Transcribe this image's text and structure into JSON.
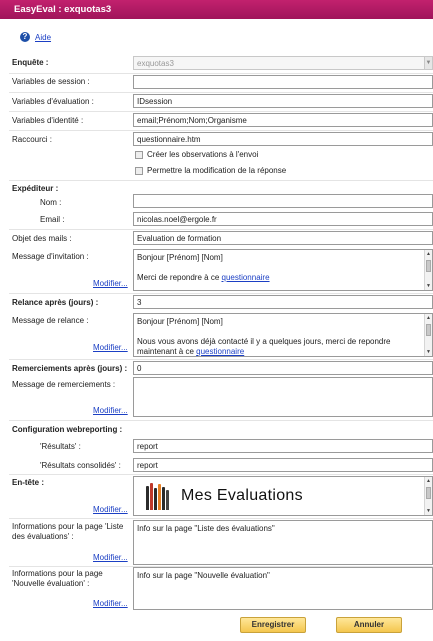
{
  "window": {
    "title": "EasyEval : exquotas3"
  },
  "help": {
    "label": "Aide"
  },
  "survey": {
    "label": "Enquête :",
    "value": "exquotas3"
  },
  "session_vars": {
    "label": "Variables de session :",
    "value": ""
  },
  "eval_vars": {
    "label": "Variables d'évaluation :",
    "value": "IDsession"
  },
  "identity_vars": {
    "label": "Variables d'identité :",
    "value": "email;Prénom;Nom;Organisme"
  },
  "shortcut": {
    "label": "Raccourci :",
    "value": "questionnaire.htm"
  },
  "options": {
    "create_obs": "Créer les observations à l'envoi",
    "allow_modify": "Permettre la modification de la réponse"
  },
  "sender": {
    "heading": "Expéditeur :",
    "name_label": "Nom :",
    "name_value": "",
    "email_label": "Email :",
    "email_value": "nicolas.noel@ergole.fr"
  },
  "mail_subject": {
    "label": "Objet des mails :",
    "value": "Evaluation de formation"
  },
  "invitation": {
    "label": "Message d'invitation :",
    "line1": "Bonjour [Prénom] [Nom]",
    "line2_prefix": "Merci de repondre à ce ",
    "link": "questionnaire",
    "modify": "Modifier..."
  },
  "reminder_days": {
    "label": "Relance après (jours) :",
    "value": "3"
  },
  "reminder": {
    "label": "Message de relance :",
    "line1": "Bonjour [Prénom] [Nom]",
    "line2": "Nous vous avons déjà contacté il y a quelques jours, merci de repondre",
    "line3_prefix": "maintenant à ce ",
    "link": "questionnaire",
    "modify": "Modifier..."
  },
  "thanks_days": {
    "label": "Remerciements après (jours) :",
    "value": "0"
  },
  "thanks": {
    "label": "Message de remerciements :",
    "modify": "Modifier..."
  },
  "webreporting": {
    "heading": "Configuration webreporting :",
    "results_label": "'Résultats' :",
    "results_value": "report",
    "consolidated_label": "'Résultats consolidés' :",
    "consolidated_value": "report"
  },
  "header": {
    "label": "En-tête :",
    "banner_text": "Mes Evaluations",
    "modify": "Modifier..."
  },
  "list_page": {
    "label": "Informations pour la page 'Liste des évaluations' :",
    "text": "Info sur la page \"Liste des évaluations\"",
    "modify": "Modifier..."
  },
  "new_page": {
    "label": "Informations pour la page 'Nouvelle évaluation' :",
    "text": "Info sur la page \"Nouvelle évaluation\"",
    "modify": "Modifier..."
  },
  "buttons": {
    "save": "Enregistrer",
    "cancel": "Annuler"
  },
  "colors": {
    "titlebar": "#b01a64",
    "link": "#1b3fc4",
    "button": "#f4c64e"
  }
}
